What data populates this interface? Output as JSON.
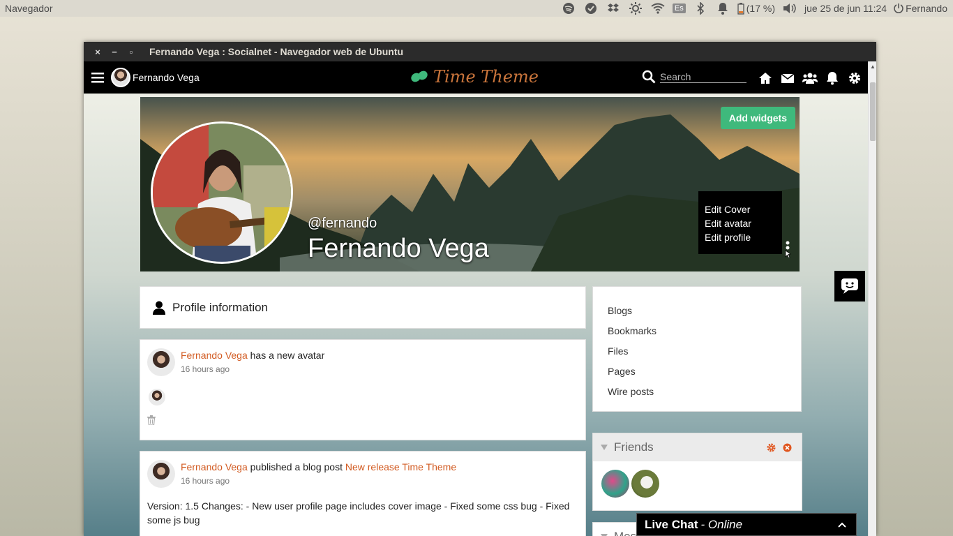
{
  "system": {
    "app_name": "Navegador",
    "keyboard_layout": "Es",
    "battery": "(17 %)",
    "datetime": "jue 25 de jun 11:24",
    "user": "Fernando"
  },
  "window": {
    "title": "Fernando Vega : Socialnet - Navegador web de Ubuntu",
    "buttons": {
      "close": "×",
      "minimize": "−",
      "maximize": "▫"
    }
  },
  "navbar": {
    "user_name": "Fernando Vega",
    "logo_text": "Time Theme",
    "search_placeholder": "Search"
  },
  "cover": {
    "add_widgets": "Add widgets",
    "handle": "@fernando",
    "full_name": "Fernando Vega",
    "menu": [
      "Edit Cover",
      "Edit avatar",
      "Edit profile"
    ]
  },
  "profile_info": {
    "label": "Profile information"
  },
  "river": [
    {
      "author": "Fernando Vega",
      "action": " has a new avatar",
      "target": "",
      "time": "16 hours ago"
    },
    {
      "author": "Fernando Vega",
      "action": " published a blog post ",
      "target": "New release Time Theme",
      "time": "16 hours ago",
      "body": "Version: 1.5 Changes: - New user profile page includes cover image - Fixed some css bug - Fixed some js bug"
    }
  ],
  "sidebar": {
    "links": [
      "Blogs",
      "Bookmarks",
      "Files",
      "Pages",
      "Wire posts"
    ],
    "friends_title": "Friends",
    "messages_title": "Mes"
  },
  "live_chat": {
    "label": "Live Chat",
    "status": "- Online"
  },
  "colors": {
    "accent_link": "#d25b22",
    "add_widgets": "#3fb97c",
    "navbar": "#000000",
    "logo": "#c8743b"
  }
}
